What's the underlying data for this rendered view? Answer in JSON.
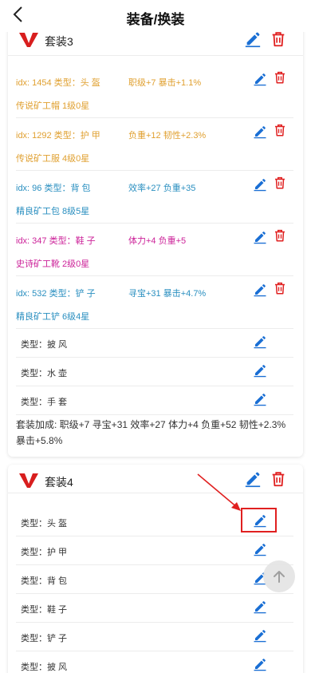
{
  "header": {
    "title": "装备/换装"
  },
  "colors": {
    "accent": "#1a6fd4",
    "delete": "#e02020",
    "legendary": "#e0a030",
    "fine": "#2a8fc0",
    "epic": "#cc2299"
  },
  "set3": {
    "name": "套装3",
    "items": [
      {
        "idx": "idx:  1454 类型：头 盔",
        "attr": "职级+7 暴击+1.1%",
        "name": "传说矿工帽 1级0星"
      },
      {
        "idx": "idx:  1292 类型：护 甲",
        "attr": "负重+12 韧性+2.3%",
        "name": "传说矿工服 4级0星"
      },
      {
        "idx": "idx:  96 类型：背 包",
        "attr": "效率+27 负重+35",
        "name": "精良矿工包 8级5星"
      },
      {
        "idx": "idx:  347 类型：鞋 子",
        "attr": "体力+4 负重+5",
        "name": "史诗矿工靴 2级0星"
      },
      {
        "idx": "idx:  532 类型：铲 子",
        "attr": "寻宝+31 暴击+4.7%",
        "name": "精良矿工铲 6级4星"
      }
    ],
    "empty_slots": [
      "类型：披 风",
      "类型：水 壶",
      "类型：手 套"
    ],
    "bonus": "套装加成:  职级+7 寻宝+31 效率+27 体力+4 负重+52  韧性+2.3%  暴击+5.8%"
  },
  "set4": {
    "name": "套装4",
    "slots": [
      "类型：头 盔",
      "类型：护 甲",
      "类型：背 包",
      "类型：鞋 子",
      "类型：铲 子",
      "类型：披 风"
    ]
  }
}
